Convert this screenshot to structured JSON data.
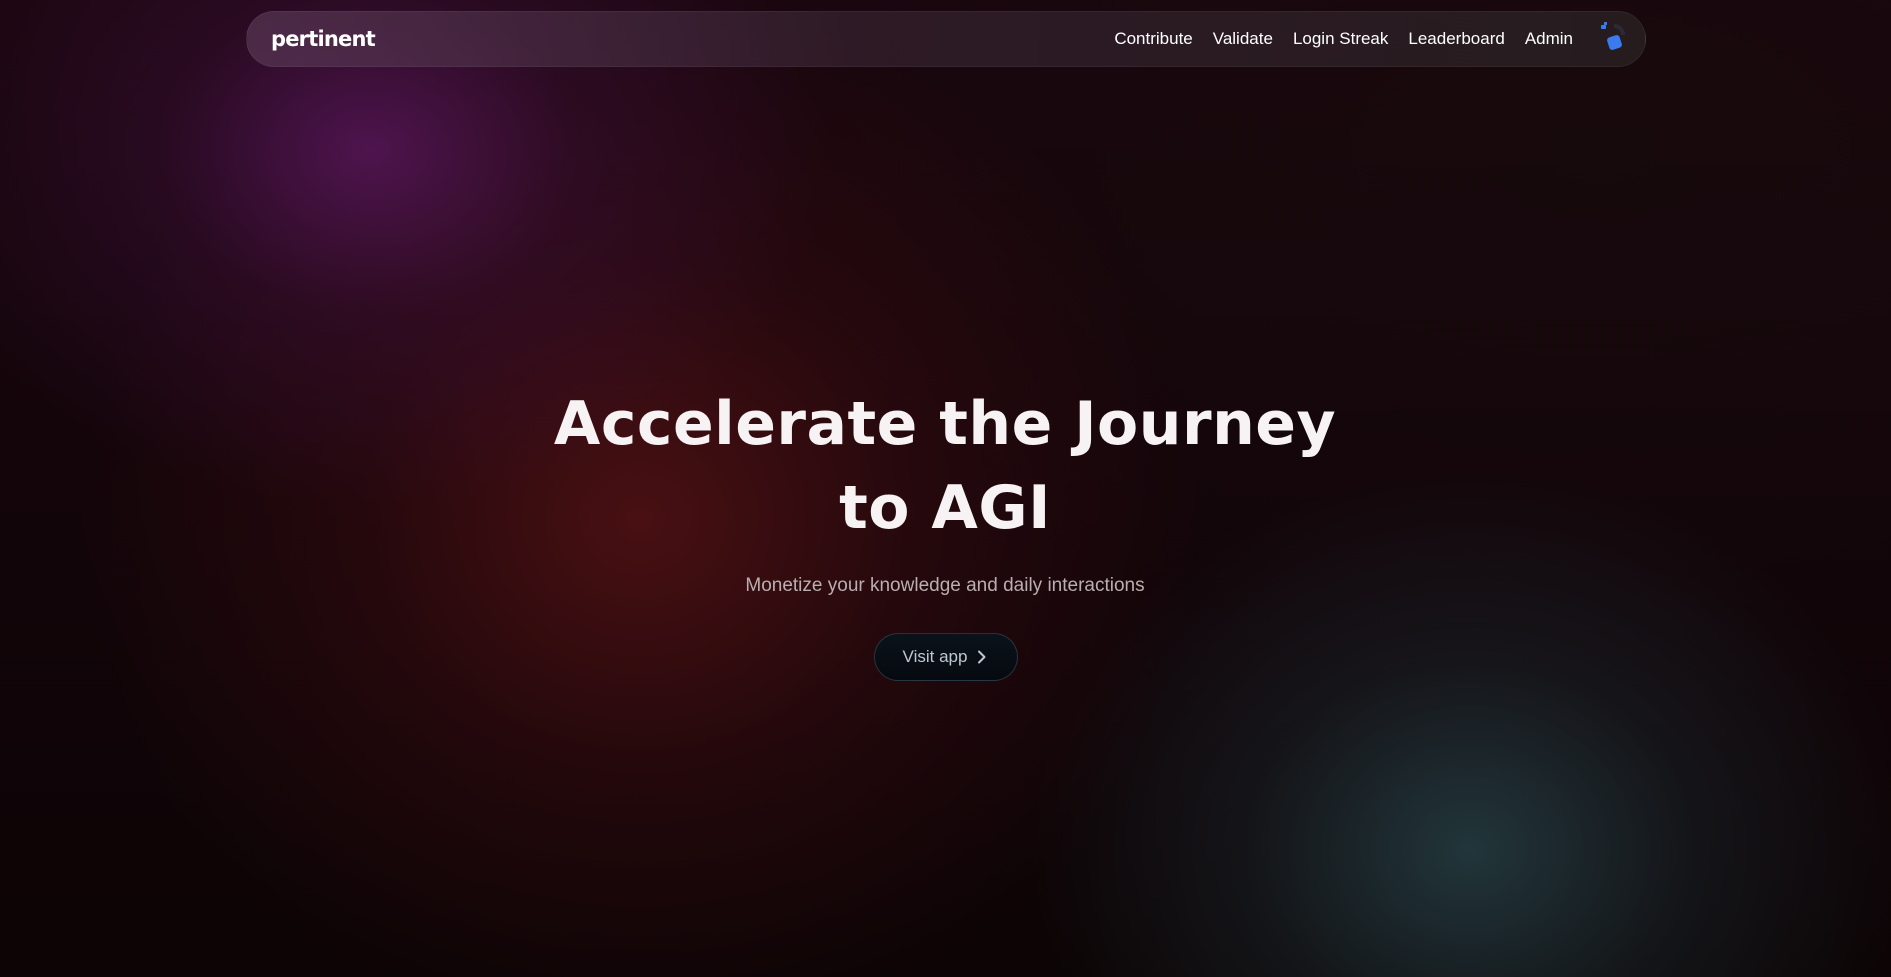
{
  "brand": {
    "logo_text": "pertinent"
  },
  "nav": {
    "items": [
      {
        "label": "Contribute"
      },
      {
        "label": "Validate"
      },
      {
        "label": "Login Streak"
      },
      {
        "label": "Leaderboard"
      },
      {
        "label": "Admin"
      }
    ],
    "avatar_icon": "user-avatar-icon"
  },
  "hero": {
    "title_line1": "Accelerate the Journey",
    "title_line2": "to AGI",
    "subtitle": "Monetize your knowledge and daily interactions",
    "cta_label": "Visit app",
    "cta_icon": "chevron-right-icon"
  },
  "colors": {
    "background_dark": "#0e0506",
    "glow_purple": "#5c1860",
    "glow_red": "#521214",
    "glow_teal": "#28464c",
    "avatar_blue": "#3a7bf0"
  }
}
